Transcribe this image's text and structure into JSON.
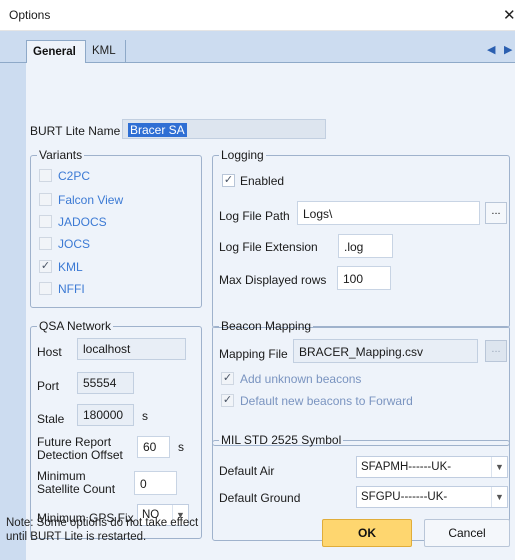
{
  "window": {
    "title": "Options",
    "close_glyph": "✕"
  },
  "tabs": [
    {
      "label": "General",
      "active": true
    },
    {
      "label": "KML",
      "active": false
    }
  ],
  "tab_nav": {
    "left_arrow": "◀",
    "right_arrow": "▶"
  },
  "general": {
    "name_label": "BURT Lite Name",
    "name_value": "Bracer SA"
  },
  "variants": {
    "legend": "Variants",
    "items": [
      {
        "label": "C2PC",
        "checked": false
      },
      {
        "label": "Falcon View",
        "checked": false
      },
      {
        "label": "JADOCS",
        "checked": false
      },
      {
        "label": "JOCS",
        "checked": false
      },
      {
        "label": "KML",
        "checked": true
      },
      {
        "label": "NFFI",
        "checked": false
      }
    ]
  },
  "logging": {
    "legend": "Logging",
    "enabled_label": "Enabled",
    "enabled": true,
    "path_label": "Log File Path",
    "path_value": "Logs\\",
    "browse_label": "...",
    "ext_label": "Log File Extension",
    "ext_value": ".log",
    "rows_label": "Max Displayed rows",
    "rows_value": "100"
  },
  "qsa": {
    "legend": "QSA Network",
    "host_label": "Host",
    "host_value": "localhost",
    "port_label": "Port",
    "port_value": "55554",
    "stale_label": "Stale",
    "stale_value": "180000",
    "stale_unit": "s",
    "future_label_1": "Future Report",
    "future_label_2": "Detection Offset",
    "future_value": "60",
    "future_unit": "s",
    "sat_label_1": "Minimum",
    "sat_label_2": "Satellite Count",
    "sat_value": "0",
    "gps_label": "Minimum GPS Fix",
    "gps_value": "NO"
  },
  "beacon": {
    "legend": "Beacon Mapping",
    "file_label": "Mapping File",
    "file_value": "BRACER_Mapping.csv",
    "browse_label": "...",
    "add_unknown_label": "Add unknown beacons",
    "add_unknown": true,
    "default_forward_label": "Default new beacons to Forward",
    "default_forward": true
  },
  "milstd": {
    "legend": "MIL STD 2525 Symbol",
    "air_label": "Default Air",
    "air_value": "SFAPMH------UK-",
    "ground_label": "Default Ground",
    "ground_value": "SFGPU-------UK-"
  },
  "footer": {
    "note_line1": "Note: Some options do not take effect",
    "note_line2": "until BURT Lite is restarted.",
    "ok_label": "OK",
    "cancel_label": "Cancel"
  },
  "icons": {
    "check": "✓",
    "dropdown": "▼"
  },
  "colors": {
    "accent_ok": "#fed66f",
    "panel": "#eef3fa",
    "frame": "#ccdcf0",
    "link_blue": "#3c7ad4"
  }
}
